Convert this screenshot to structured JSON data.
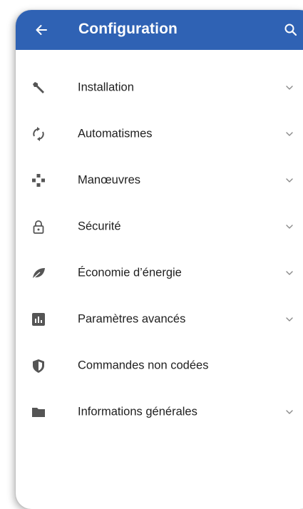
{
  "appbar": {
    "title": "Configuration",
    "color": "#2f62b4",
    "back_icon": "arrow-left-icon",
    "search_icon": "search-icon"
  },
  "menu": {
    "items": [
      {
        "label": "Installation",
        "icon": "wrench-icon",
        "expandable": true
      },
      {
        "label": "Automatismes",
        "icon": "sync-icon",
        "expandable": true
      },
      {
        "label": "Manœuvres",
        "icon": "move-arrows-icon",
        "expandable": true
      },
      {
        "label": "Sécurité",
        "icon": "lock-icon",
        "expandable": true
      },
      {
        "label": "Économie d’énergie",
        "icon": "leaf-icon",
        "expandable": true
      },
      {
        "label": "Paramètres avancés",
        "icon": "bar-chart-icon",
        "expandable": true
      },
      {
        "label": "Commandes non codées",
        "icon": "shield-icon",
        "expandable": false
      },
      {
        "label": "Informations générales",
        "icon": "folder-icon",
        "expandable": true
      }
    ]
  }
}
